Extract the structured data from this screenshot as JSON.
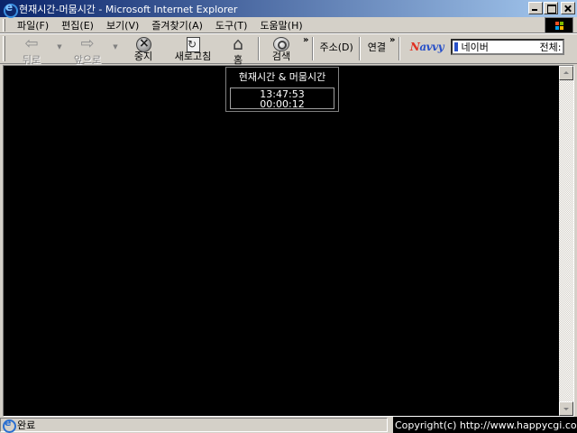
{
  "window": {
    "title": "현재시간-머뭄시간 - Microsoft Internet Explorer"
  },
  "menu": [
    {
      "label": "파일(F)"
    },
    {
      "label": "편집(E)"
    },
    {
      "label": "보기(V)"
    },
    {
      "label": "즐겨찾기(A)"
    },
    {
      "label": "도구(T)"
    },
    {
      "label": "도움말(H)"
    }
  ],
  "toolbar": {
    "back_label": "뒤로",
    "forward_label": "앞으로",
    "stop_label": "중지",
    "refresh_label": "새로고침",
    "home_label": "홈",
    "search_label": "검색",
    "address_label": "주소(D)",
    "links_label": "연결",
    "chevron": "»"
  },
  "search_widget": {
    "logo": "Navvy",
    "value": "네이버",
    "scope": "전체:"
  },
  "clock": {
    "title": "현재시간 & 머뭄시간",
    "current_time": "13:47:53",
    "elapsed_time": "00:00:12"
  },
  "status": {
    "text": "완료",
    "copyright": "Copyright(c) http://www.happycgi.com"
  },
  "colors": {
    "titlebar_start": "#0a246a",
    "titlebar_end": "#a6caf0",
    "content_bg": "#000000",
    "chrome": "#d4d0c8"
  }
}
